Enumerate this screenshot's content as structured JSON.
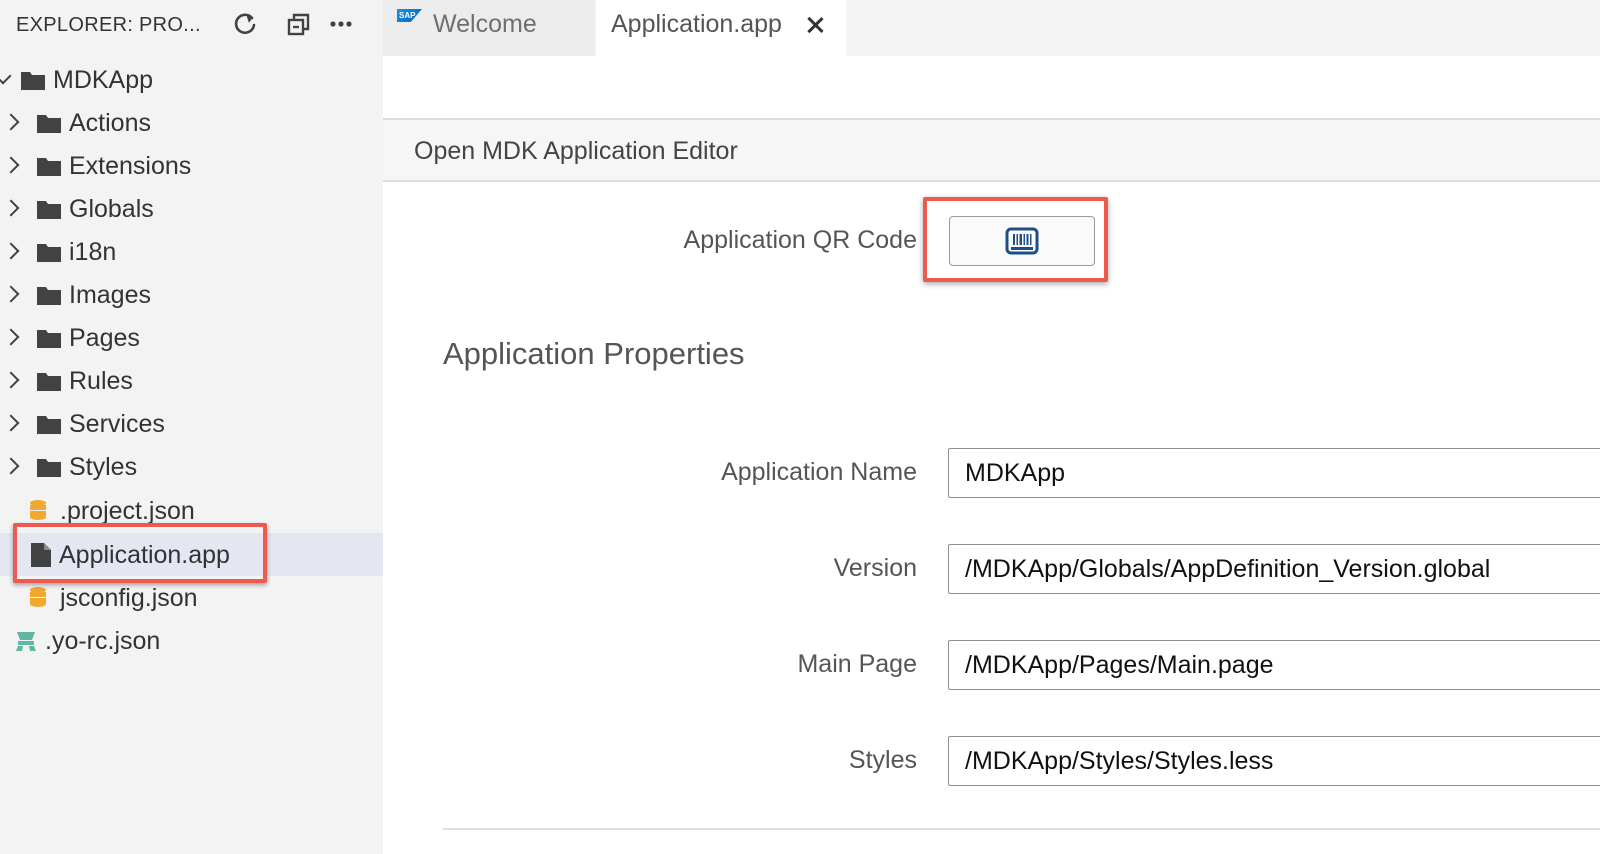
{
  "explorer": {
    "title": "EXPLORER: PRO...",
    "actions": [
      "refresh-icon",
      "collapse-all-icon",
      "more-icon"
    ],
    "root": {
      "label": "MDKApp",
      "expanded": true
    },
    "folders": [
      "Actions",
      "Extensions",
      "Globals",
      "i18n",
      "Images",
      "Pages",
      "Rules",
      "Services",
      "Styles"
    ],
    "files": [
      ".project.json",
      "Application.app",
      "jsconfig.json"
    ],
    "root_file": ".yo-rc.json",
    "selected_file": "Application.app"
  },
  "tabs": [
    {
      "label": "Welcome",
      "icon": "sap-logo-icon",
      "active": false
    },
    {
      "label": "Application.app",
      "active": true
    }
  ],
  "editor": {
    "heading": "Open MDK Application Editor",
    "qr_label": "Application QR Code",
    "qr_button_icon": "barcode-icon",
    "section_title": "Application Properties",
    "fields": [
      {
        "label": "Application Name",
        "value": "MDKApp"
      },
      {
        "label": "Version",
        "value": "/MDKApp/Globals/AppDefinition_Version.global"
      },
      {
        "label": "Main Page",
        "value": "/MDKApp/Pages/Main.page"
      },
      {
        "label": "Styles",
        "value": "/MDKApp/Styles/Styles.less"
      }
    ]
  },
  "colors": {
    "highlight": "#ef5a50",
    "json_icon": "#f0a830",
    "yo_icon": "#5fb7a6",
    "selected_row": "#e4e6f1"
  }
}
